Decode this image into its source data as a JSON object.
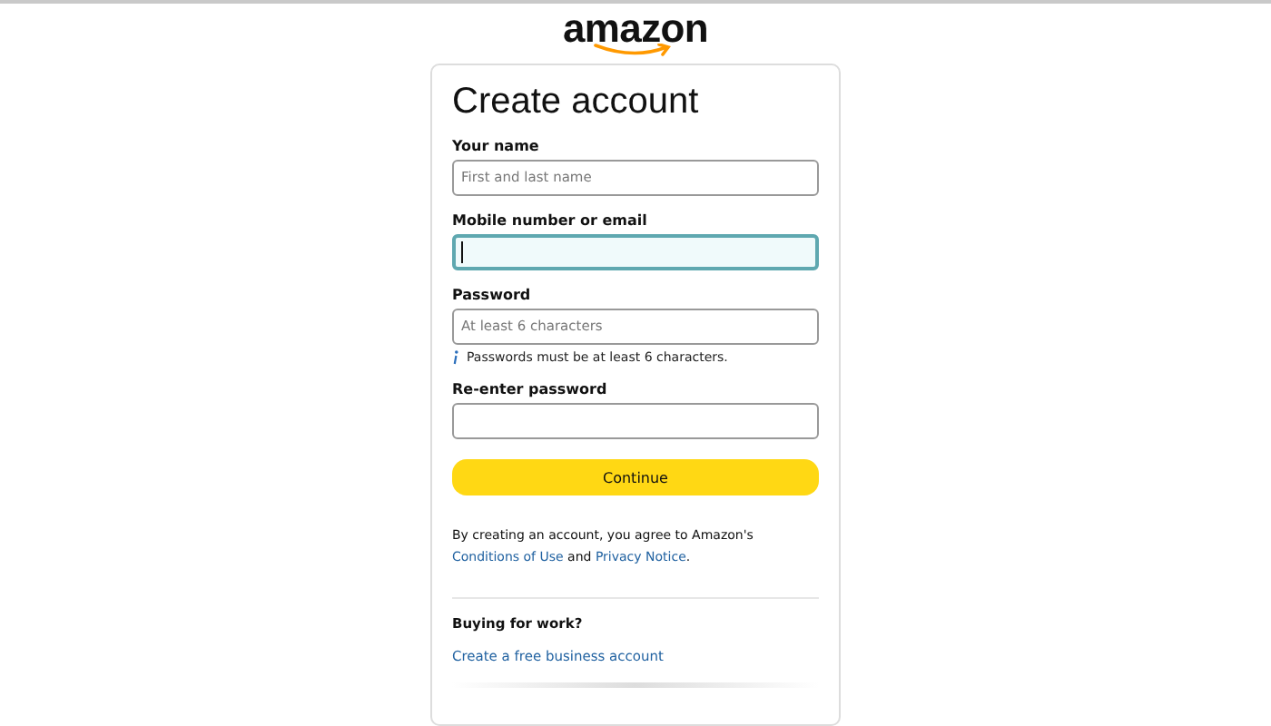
{
  "logo": {
    "text": "amazon"
  },
  "title": "Create account",
  "fields": [
    {
      "label": "Your name",
      "placeholder": "First and last name",
      "focused": false
    },
    {
      "label": "Mobile number or email",
      "focused": true
    },
    {
      "label": "Password",
      "placeholder": "At least 6 characters",
      "focused": false,
      "hint": "Passwords must be at least 6 characters."
    },
    {
      "label": "Re-enter password",
      "focused": false
    }
  ],
  "continue_button": "Continue",
  "legal": {
    "before": "By creating an account, you agree to Amazon's",
    "link_1": "Conditions of Use",
    "middle": "and",
    "link_2": "Privacy Notice",
    "after": "."
  },
  "business": {
    "heading": "Buying for work?",
    "link": "Create a free business account"
  }
}
